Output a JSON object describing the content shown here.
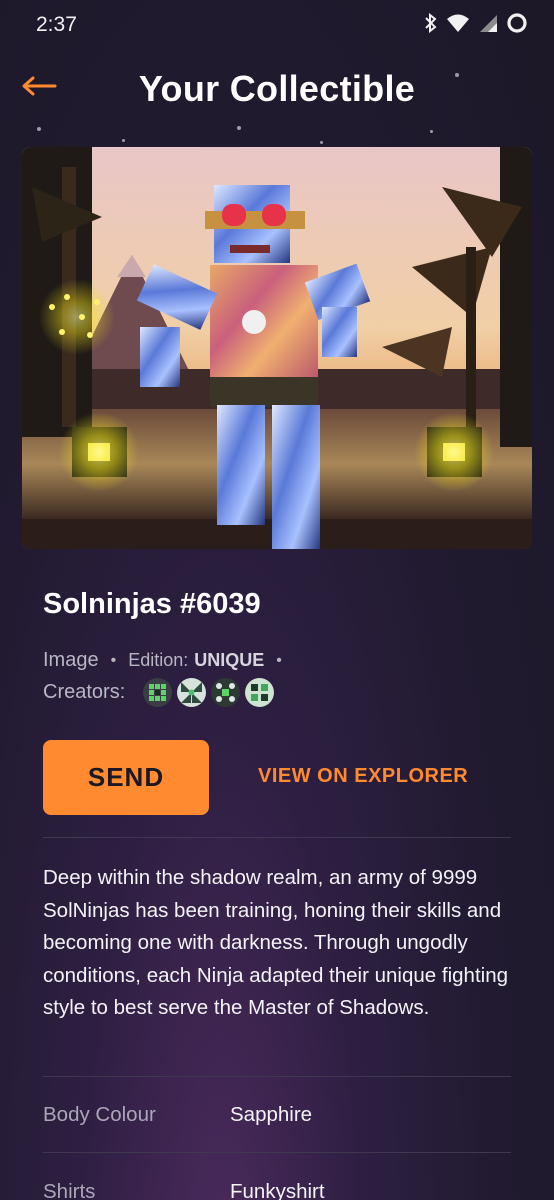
{
  "status_bar": {
    "time": "2:37",
    "icons": [
      "bluetooth-icon",
      "wifi-icon",
      "signal-icon",
      "battery-icon"
    ]
  },
  "header": {
    "title": "Your Collectible",
    "back_icon": "arrow-left-icon"
  },
  "colors": {
    "accent": "#ff8a2f",
    "background": "#1c1827",
    "text_primary": "#ffffff",
    "text_secondary": "#b9b6c4"
  },
  "nft": {
    "name": "Solninjas #6039",
    "type": "Image",
    "edition_label": "Edition:",
    "edition_value": "UNIQUE",
    "creators_label": "Creators:",
    "creators_count": 4
  },
  "actions": {
    "send_label": "SEND",
    "explorer_label": "VIEW ON EXPLORER"
  },
  "description": "Deep within the shadow realm, an army of 9999 SolNinjas has been training, honing their skills and becoming one with darkness. Through ungodly conditions, each Ninja adapted their unique fighting style to best serve the Master of Shadows.",
  "attributes": [
    {
      "label": "Body Colour",
      "value": "Sapphire"
    },
    {
      "label": "Shirts",
      "value": "Funkyshirt"
    }
  ]
}
